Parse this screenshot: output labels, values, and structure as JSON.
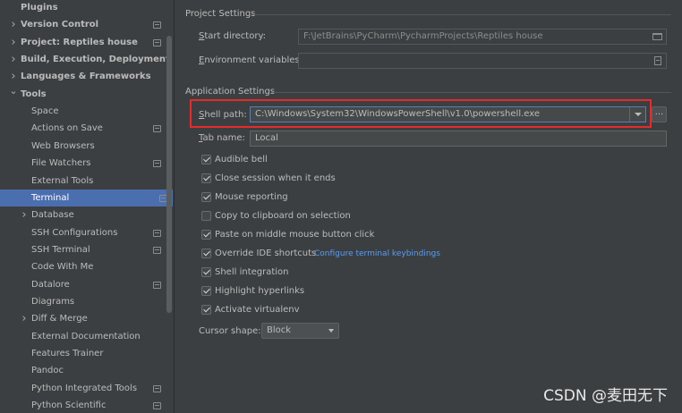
{
  "sidebar": {
    "items": [
      {
        "label": "Plugins",
        "bold": true,
        "arrow": "",
        "indent": 0,
        "sub": false
      },
      {
        "label": "Version Control",
        "bold": true,
        "arrow": "right",
        "indent": 0,
        "sub": true
      },
      {
        "label": "Project: Reptiles house",
        "bold": true,
        "arrow": "right",
        "indent": 0,
        "sub": true
      },
      {
        "label": "Build, Execution, Deployment",
        "bold": true,
        "arrow": "right",
        "indent": 0,
        "sub": false
      },
      {
        "label": "Languages & Frameworks",
        "bold": true,
        "arrow": "right",
        "indent": 0,
        "sub": false
      },
      {
        "label": "Tools",
        "bold": true,
        "arrow": "down",
        "indent": 0,
        "sub": false
      },
      {
        "label": "Space",
        "bold": false,
        "arrow": "",
        "indent": 1,
        "sub": false
      },
      {
        "label": "Actions on Save",
        "bold": false,
        "arrow": "",
        "indent": 1,
        "sub": true
      },
      {
        "label": "Web Browsers",
        "bold": false,
        "arrow": "",
        "indent": 1,
        "sub": false
      },
      {
        "label": "File Watchers",
        "bold": false,
        "arrow": "",
        "indent": 1,
        "sub": true
      },
      {
        "label": "External Tools",
        "bold": false,
        "arrow": "",
        "indent": 1,
        "sub": false
      },
      {
        "label": "Terminal",
        "bold": false,
        "arrow": "",
        "indent": 1,
        "sub": true,
        "selected": true
      },
      {
        "label": "Database",
        "bold": false,
        "arrow": "right",
        "indent": 1,
        "sub": false
      },
      {
        "label": "SSH Configurations",
        "bold": false,
        "arrow": "",
        "indent": 1,
        "sub": true
      },
      {
        "label": "SSH Terminal",
        "bold": false,
        "arrow": "",
        "indent": 1,
        "sub": true
      },
      {
        "label": "Code With Me",
        "bold": false,
        "arrow": "",
        "indent": 1,
        "sub": false
      },
      {
        "label": "Datalore",
        "bold": false,
        "arrow": "",
        "indent": 1,
        "sub": true
      },
      {
        "label": "Diagrams",
        "bold": false,
        "arrow": "",
        "indent": 1,
        "sub": false
      },
      {
        "label": "Diff & Merge",
        "bold": false,
        "arrow": "right",
        "indent": 1,
        "sub": false
      },
      {
        "label": "External Documentation",
        "bold": false,
        "arrow": "",
        "indent": 1,
        "sub": false
      },
      {
        "label": "Features Trainer",
        "bold": false,
        "arrow": "",
        "indent": 1,
        "sub": false
      },
      {
        "label": "Pandoc",
        "bold": false,
        "arrow": "",
        "indent": 1,
        "sub": false
      },
      {
        "label": "Python Integrated Tools",
        "bold": false,
        "arrow": "",
        "indent": 1,
        "sub": true
      },
      {
        "label": "Python Scientific",
        "bold": false,
        "arrow": "",
        "indent": 1,
        "sub": true
      }
    ]
  },
  "project_settings": {
    "title": "Project Settings",
    "start_dir_label_pre": "",
    "start_dir_mnemonic": "S",
    "start_dir_label_post": "tart directory:",
    "start_dir_value": "F:\\JetBrains\\PyCharm\\PycharmProjects\\Reptiles house",
    "env_label_pre": "",
    "env_mnemonic": "E",
    "env_label_post": "nvironment variables:",
    "env_value": ""
  },
  "application_settings": {
    "title": "Application Settings",
    "shell_mnemonic": "S",
    "shell_label_post": "hell path:",
    "shell_value": "C:\\Windows\\System32\\WindowsPowerShell\\v1.0\\powershell.exe",
    "browse_label": "...",
    "tab_mnemonic": "T",
    "tab_label_post": "ab name:",
    "tab_value": "Local",
    "checkboxes": [
      {
        "label": "Audible bell",
        "checked": true
      },
      {
        "label": "Close session when it ends",
        "checked": true
      },
      {
        "label": "Mouse reporting",
        "checked": true
      },
      {
        "label": "Copy to clipboard on selection",
        "checked": false
      },
      {
        "label": "Paste on middle mouse button click",
        "checked": true
      },
      {
        "label": "Override IDE shortcuts",
        "checked": true
      },
      {
        "label": "Shell integration",
        "checked": true
      },
      {
        "label": "Highlight hyperlinks",
        "checked": true
      },
      {
        "label": "Activate virtualenv",
        "checked": true
      }
    ],
    "configure_link": "Configure terminal keybindings",
    "cursor_label": "Cursor shape:",
    "cursor_value": "Block"
  },
  "watermark": "CSDN @麦田无下",
  "colors": {
    "background": "#3c3f41",
    "selection": "#4b6eaf",
    "highlight_border": "#e52b2b",
    "link": "#589df6"
  }
}
